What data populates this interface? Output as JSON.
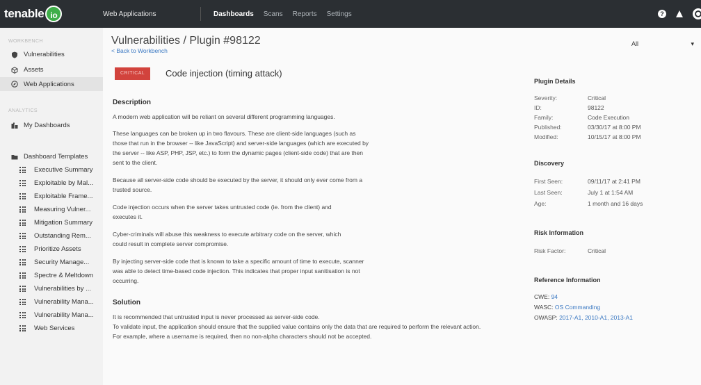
{
  "topbar": {
    "logo_text": "tenable",
    "logo_suffix": "io",
    "app_label": "Web Applications",
    "nav": [
      "Dashboards",
      "Scans",
      "Reports",
      "Settings"
    ],
    "icons": [
      "help-icon",
      "bell-icon",
      "user-icon"
    ]
  },
  "sidebar": {
    "workbench_heading": "WORKBENCH",
    "workbench_items": [
      {
        "label": "Vulnerabilities",
        "icon": "shield-icon"
      },
      {
        "label": "Assets",
        "icon": "cube-icon"
      },
      {
        "label": "Web Applications",
        "icon": "compass-icon"
      }
    ],
    "analytics_heading": "ANALYTICS",
    "my_dashboards": "My Dashboards",
    "dashboard_templates": "Dashboard Templates",
    "templates": [
      "Executive Summary",
      "Exploitable by Mal...",
      "Exploitable Frame...",
      "Measuring Vulner...",
      "Mitigation Summary",
      "Outstanding Rem...",
      "Prioritize Assets",
      "Security Manage...",
      "Spectre & Meltdown",
      "Vulnerabilities by ...",
      "Vulnerability Mana...",
      "Vulnerability Mana...",
      "Web Services"
    ]
  },
  "main": {
    "title": "Vulnerabilities / Plugin #98122",
    "back_link": "< Back to Workbench",
    "filter": "All",
    "severity_badge": "CRITICAL",
    "vuln_name": "Code injection (timing attack)",
    "description_heading": "Description",
    "description": [
      "A modern web application will be reliant on several different programming languages.",
      "These languages can be broken up in two flavours. These are client-side languages (such as those that run in the browser -- like JavaScript) and server-side languages (which are executed by the server -- like ASP, PHP, JSP, etc.) to form the dynamic pages (client-side code) that are then sent to the client.",
      "Because all server-side code should be executed by the server, it should only ever come from a trusted source.",
      "Code injection occurs when the server takes untrusted code (ie. from the client) and executes it.",
      "Cyber-criminals will abuse this weakness to execute arbitrary code on the server, which could result in complete server compromise.",
      "By injecting server-side code that is known to take a specific amount of time to execute, scanner was able to detect time-based code injection. This indicates that proper input sanitisation is not occurring."
    ],
    "solution_heading": "Solution",
    "solution": [
      "It is recommended that untrusted input is never processed as server-side code.",
      "To validate input, the application should ensure that the supplied value contains only the data that are required to perform the relevant action.",
      "For example, where a username is required, then no non-alpha characters should not be accepted."
    ]
  },
  "details": {
    "plugin_heading": "Plugin Details",
    "plugin": [
      {
        "k": "Severity:",
        "v": "Critical"
      },
      {
        "k": "ID:",
        "v": "98122"
      },
      {
        "k": "Family:",
        "v": "Code Execution"
      },
      {
        "k": "Published:",
        "v": "03/30/17 at 8:00 PM"
      },
      {
        "k": "Modified:",
        "v": "10/15/17 at 8:00 PM"
      }
    ],
    "discovery_heading": "Discovery",
    "discovery": [
      {
        "k": "First Seen:",
        "v": "09/11/17 at 2:41 PM"
      },
      {
        "k": "Last Seen:",
        "v": "July 1 at 1:54 AM"
      },
      {
        "k": "Age:",
        "v": "1 month and 16 days"
      }
    ],
    "risk_heading": "Risk Information",
    "risk": [
      {
        "k": "Risk Factor:",
        "v": "Critical"
      }
    ],
    "reference_heading": "Reference Information",
    "references": [
      {
        "label": "CWE:",
        "links": "94"
      },
      {
        "label": "WASC:",
        "links": "OS Commanding"
      },
      {
        "label": "OWASP:",
        "links": "2017-A1, 2010-A1, 2013-A1"
      }
    ]
  }
}
